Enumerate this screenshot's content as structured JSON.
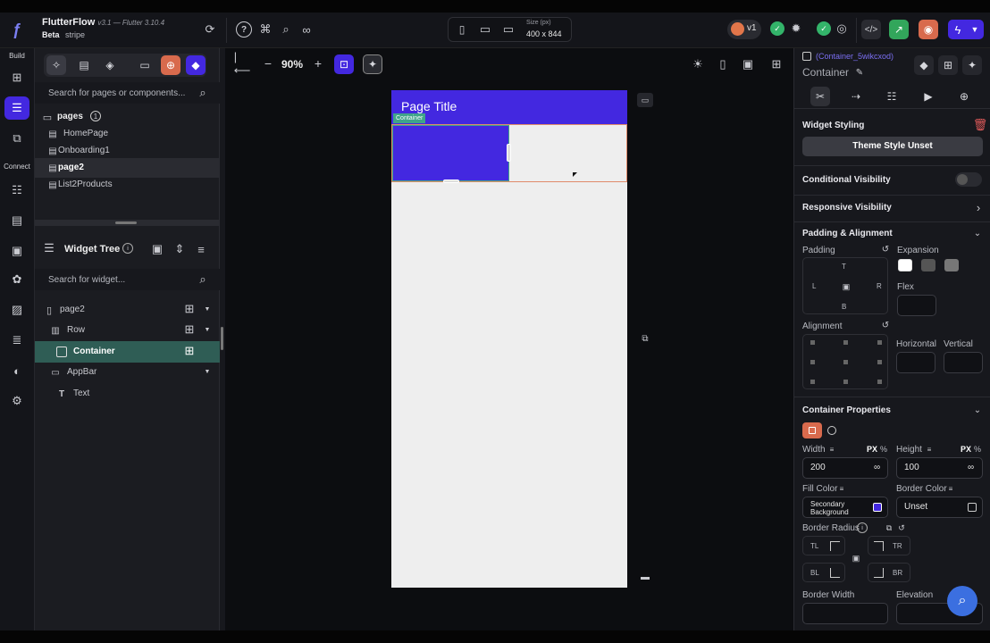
{
  "header": {
    "app_name": "FlutterFlow",
    "version": "v3.1 — Flutter 3.10.4",
    "badge": "Beta",
    "project": "stripe",
    "size_label": "Size (px)",
    "size_value": "400 x 844",
    "version_chip": "v1"
  },
  "rail": {
    "build_label": "Build",
    "connect_label": "Connect"
  },
  "pages": {
    "search_placeholder": "Search for pages or components...",
    "folder_label": "pages",
    "info_badge": "1",
    "items": [
      "HomePage",
      "Onboarding1",
      "page2",
      "List2Products"
    ]
  },
  "widget_tree": {
    "title": "Widget Tree",
    "search_placeholder": "Search for widget...",
    "nodes": [
      "page2",
      "Row",
      "Container",
      "AppBar",
      "Text"
    ]
  },
  "canvas_toolbar": {
    "zoom": "90%"
  },
  "device": {
    "appbar_title": "Page Title",
    "selection_tag": "Container",
    "appbar_color": "#4328e0",
    "selected_fill": "#4328e0",
    "body_color": "#eeeeee"
  },
  "props": {
    "widget_id": "(Container_5wikcxod)",
    "widget_type": "Container",
    "widget_styling": "Widget Styling",
    "theme_button": "Theme Style Unset",
    "conditional_visibility": "Conditional Visibility",
    "responsive_visibility": "Responsive Visibility",
    "padding_alignment": "Padding & Alignment",
    "padding": "Padding",
    "expansion": "Expansion",
    "pad_t": "T",
    "pad_l": "L",
    "pad_r": "R",
    "pad_b": "B",
    "flex": "Flex",
    "alignment": "Alignment",
    "horizontal": "Horizontal",
    "vertical": "Vertical",
    "container_properties": "Container Properties",
    "width_label": "Width",
    "height_label": "Height",
    "unit_px": "PX",
    "unit_pct": "%",
    "width_value": "200",
    "height_value": "100",
    "infinity": "∞",
    "fill_color_label": "Fill Color",
    "fill_color_value": "Secondary Background",
    "border_color_label": "Border Color",
    "border_color_value": "Unset",
    "border_radius": "Border Radius",
    "tl": "TL",
    "tr": "TR",
    "bl": "BL",
    "br": "BR",
    "border_width": "Border Width",
    "elevation": "Elevation",
    "accent": "#4328e0"
  }
}
